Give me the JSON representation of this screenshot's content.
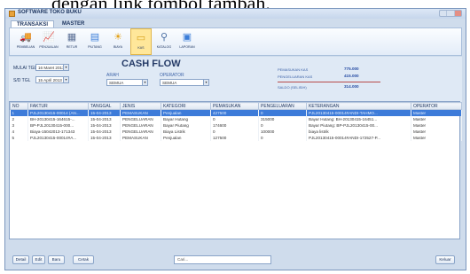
{
  "caption_fragment": "dengan link tombol tambah.",
  "window": {
    "title": "SOFTWARE TOKO BUKU"
  },
  "menu_tabs": [
    "TRANSAKSI",
    "MASTER"
  ],
  "ribbon": [
    {
      "label": "PEMBELIAN",
      "icon": "truck-icon",
      "glyph": "🚚",
      "color": "#3b7dd8"
    },
    {
      "label": "PENJUALAN",
      "icon": "chart-up-icon",
      "glyph": "📈",
      "color": "#3a9c3a"
    },
    {
      "label": "RETUR",
      "icon": "box-icon",
      "glyph": "▦",
      "color": "#5a6f95"
    },
    {
      "label": "PIUTANG",
      "icon": "document-icon",
      "glyph": "▤",
      "color": "#3b7dd8"
    },
    {
      "label": "BIAYA",
      "icon": "sun-icon",
      "glyph": "☀",
      "color": "#e3a21a"
    },
    {
      "label": "KAS",
      "icon": "cash-icon",
      "glyph": "▭",
      "color": "#d6a01a"
    },
    {
      "label": "KATALOG",
      "icon": "magnifier-icon",
      "glyph": "⚲",
      "color": "#4b6fa3"
    },
    {
      "label": "LAPORAN",
      "icon": "report-icon",
      "glyph": "▣",
      "color": "#3b7dd8"
    }
  ],
  "filter": {
    "from_label": "MULAI TGL",
    "from_value": "16 Maret 2013",
    "to_label": "S/D TGL",
    "to_value": "15 April 2013",
    "title": "CASH FLOW",
    "arah_label": "ARAH",
    "arah_value": "SEMUA",
    "operator_label": "OPERATOR",
    "operator_value": "SEMUA"
  },
  "summary": {
    "masuk_label": "PEMASUKAN KAS",
    "masuk_value": "775.000",
    "keluar_label": "PENGELUARAN KAS",
    "keluar_value": "415.000",
    "saldo_label": "SALDO (SELISIH)",
    "saldo_value": "314.000"
  },
  "table": {
    "headers": [
      "NO",
      "FAKTUR",
      "TANGGAL",
      "JENIS",
      "KATEGORI",
      "PEMASUKAN",
      "PENGELUARAN",
      "KETERANGAN",
      "OPERATOR"
    ],
    "rows": [
      [
        "1",
        "PJL20130415-00014 (AN...",
        "15-04-2013",
        "PEMASUKAN",
        "Penjualan",
        "427500",
        "0",
        "PJL20130415-00014#ANDI-TAHMO...",
        "Master"
      ],
      [
        "2",
        "BH-20130415-164615-...",
        "15-04-2013",
        "PENGELUARAN",
        "Bayar Hutang",
        "0",
        "315000",
        "Bayar Hutang: BH-20130415-16451...",
        "Master"
      ],
      [
        "3",
        "BP-PJL20130415-000...",
        "15-04-2013",
        "PENGELUARAN",
        "Bayar Piutang",
        "174600",
        "0",
        "Bayar Piutang: BP-PJL20130415-00...",
        "Master"
      ],
      [
        "4",
        "Biaya-15042013-171343",
        "15-04-2013",
        "PENGELUARAN",
        "Biaya Listrik",
        "0",
        "100000",
        "biaya listrik",
        "Master"
      ],
      [
        "5",
        "PJL20130415-00014#A...",
        "15-04-2013",
        "PEMASUKAN",
        "Penjualan",
        "127500",
        "0",
        "PJL20130415-00014#ANDI-172527-P...",
        "Master"
      ]
    ]
  },
  "bottom": {
    "detail": "Detail",
    "edit": "Edit",
    "baru": "Baru",
    "cetak": "Cetak",
    "search_placeholder": "Cari...",
    "keluar": "Keluar"
  }
}
